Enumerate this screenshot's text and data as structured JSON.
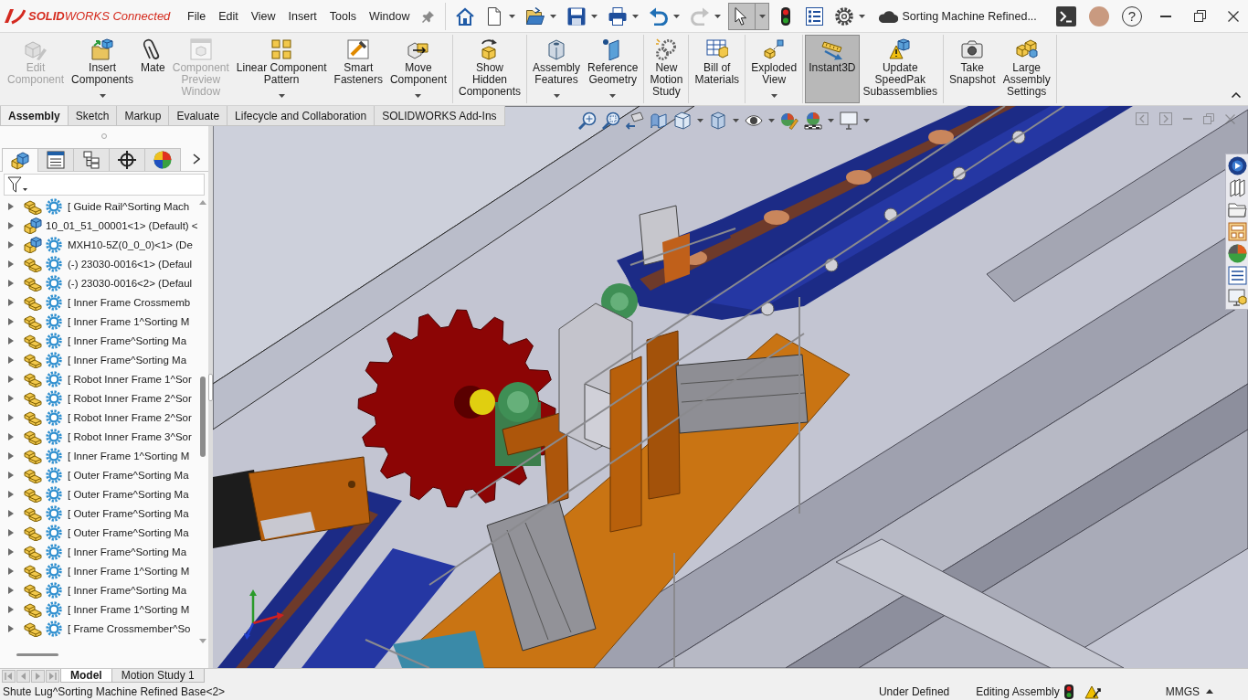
{
  "title_bar": {
    "logo": "**SOLID**WORKS Connected",
    "menu": [
      "File",
      "Edit",
      "View",
      "Insert",
      "Tools",
      "Window"
    ],
    "toolbar": [
      {
        "dropdown": false,
        "disabled": false,
        "on": false
      },
      {
        "dropdown": true,
        "disabled": false,
        "on": false
      },
      {
        "dropdown": true,
        "disabled": false,
        "on": false
      },
      {
        "dropdown": true,
        "disabled": false,
        "on": false
      },
      {
        "dropdown": true,
        "disabled": false,
        "on": false
      },
      {
        "dropdown": true,
        "disabled": false,
        "on": false
      },
      {
        "dropdown": true,
        "disabled": true,
        "on": false
      },
      {
        "dropdown": true,
        "disabled": false,
        "on": true
      },
      {
        "dropdown": false,
        "disabled": false,
        "on": false
      },
      {
        "dropdown": false,
        "disabled": false,
        "on": false
      },
      {
        "dropdown": true,
        "disabled": false,
        "on": false
      }
    ],
    "document_title": "Sorting Machine Refined...",
    "help": "?"
  },
  "ribbon": {
    "groups": [
      {
        "buttons": [
          {
            "label": "Edit\nComponent",
            "disabled": true,
            "dropdown": false,
            "on": false
          },
          {
            "label": "Insert\nComponents",
            "disabled": false,
            "dropdown": true,
            "on": false
          },
          {
            "label": "Mate",
            "disabled": false,
            "dropdown": false,
            "on": false
          },
          {
            "label": "Component\nPreview\nWindow",
            "disabled": true,
            "dropdown": false,
            "on": false
          },
          {
            "label": "Linear Component\nPattern",
            "disabled": false,
            "dropdown": true,
            "on": false
          },
          {
            "label": "Smart\nFasteners",
            "disabled": false,
            "dropdown": false,
            "on": false
          },
          {
            "label": "Move\nComponent",
            "disabled": false,
            "dropdown": true,
            "on": false
          }
        ]
      },
      {
        "buttons": [
          {
            "label": "Show\nHidden\nComponents",
            "disabled": false,
            "dropdown": false,
            "on": false
          }
        ]
      },
      {
        "buttons": [
          {
            "label": "Assembly\nFeatures",
            "disabled": false,
            "dropdown": true,
            "on": false
          },
          {
            "label": "Reference\nGeometry",
            "disabled": false,
            "dropdown": true,
            "on": false
          }
        ]
      },
      {
        "buttons": [
          {
            "label": "New\nMotion\nStudy",
            "disabled": false,
            "dropdown": false,
            "on": false
          }
        ]
      },
      {
        "buttons": [
          {
            "label": "Bill of\nMaterials",
            "disabled": false,
            "dropdown": false,
            "on": false
          }
        ]
      },
      {
        "buttons": [
          {
            "label": "Exploded\nView",
            "disabled": false,
            "dropdown": true,
            "on": false
          }
        ]
      },
      {
        "buttons": [
          {
            "label": "Instant3D",
            "disabled": false,
            "dropdown": false,
            "on": true
          },
          {
            "label": "Update\nSpeedPak\nSubassemblies",
            "disabled": false,
            "dropdown": false,
            "on": false
          }
        ]
      },
      {
        "buttons": [
          {
            "label": "Take\nSnapshot",
            "disabled": false,
            "dropdown": false,
            "on": false
          },
          {
            "label": "Large\nAssembly\nSettings",
            "disabled": false,
            "dropdown": false,
            "on": false
          }
        ]
      }
    ]
  },
  "command_tabs": [
    {
      "label": "Assembly",
      "selected": true
    },
    {
      "label": "Sketch",
      "selected": false
    },
    {
      "label": "Markup",
      "selected": false
    },
    {
      "label": "Evaluate",
      "selected": false
    },
    {
      "label": "Lifecycle and Collaboration",
      "selected": false
    },
    {
      "label": "SOLIDWORKS Add-Ins",
      "selected": false
    }
  ],
  "feature_manager": {
    "tabs": [
      {
        "selected": true
      },
      {
        "selected": false
      },
      {
        "selected": false
      },
      {
        "selected": false
      },
      {
        "selected": false
      }
    ],
    "tree": [
      {
        "label": "[ Guide Rail^Sorting Mach",
        "kind": "assembly",
        "managed": true,
        "expanded": false
      },
      {
        "label": "10_01_51_00001<1> (Default) <",
        "kind": "part",
        "managed": false,
        "expanded": false
      },
      {
        "label": "MXH10-5Z(0_0_0)<1> (De",
        "kind": "part",
        "managed": true,
        "expanded": false
      },
      {
        "label": "(-) 23030-0016<1> (Defaul",
        "kind": "assembly",
        "managed": true,
        "expanded": false
      },
      {
        "label": "(-) 23030-0016<2> (Defaul",
        "kind": "assembly",
        "managed": true,
        "expanded": false
      },
      {
        "label": "[ Inner Frame Crossmemb",
        "kind": "assembly",
        "managed": true,
        "expanded": false
      },
      {
        "label": "[ Inner Frame 1^Sorting M",
        "kind": "assembly",
        "managed": true,
        "expanded": false
      },
      {
        "label": "[ Inner Frame^Sorting Ma",
        "kind": "assembly",
        "managed": true,
        "expanded": false
      },
      {
        "label": "[ Inner Frame^Sorting Ma",
        "kind": "assembly",
        "managed": true,
        "expanded": false
      },
      {
        "label": "[ Robot Inner Frame 1^Sor",
        "kind": "assembly",
        "managed": true,
        "expanded": false
      },
      {
        "label": "[ Robot Inner Frame 2^Sor",
        "kind": "assembly",
        "managed": true,
        "expanded": false
      },
      {
        "label": "[ Robot Inner Frame 2^Sor",
        "kind": "assembly",
        "managed": true,
        "expanded": false
      },
      {
        "label": "[ Robot Inner Frame 3^Sor",
        "kind": "assembly",
        "managed": true,
        "expanded": false
      },
      {
        "label": "[ Inner Frame 1^Sorting M",
        "kind": "assembly",
        "managed": true,
        "expanded": false
      },
      {
        "label": "[ Outer Frame^Sorting Ma",
        "kind": "assembly",
        "managed": true,
        "expanded": false
      },
      {
        "label": "[ Outer Frame^Sorting Ma",
        "kind": "assembly",
        "managed": true,
        "expanded": false
      },
      {
        "label": "[ Outer Frame^Sorting Ma",
        "kind": "assembly",
        "managed": true,
        "expanded": false
      },
      {
        "label": "[ Outer Frame^Sorting Ma",
        "kind": "assembly",
        "managed": true,
        "expanded": false
      },
      {
        "label": "[ Inner Frame^Sorting Ma",
        "kind": "assembly",
        "managed": true,
        "expanded": false
      },
      {
        "label": "[ Inner Frame 1^Sorting M",
        "kind": "assembly",
        "managed": true,
        "expanded": false
      },
      {
        "label": "[ Inner Frame^Sorting Ma",
        "kind": "assembly",
        "managed": true,
        "expanded": false
      },
      {
        "label": "[ Inner Frame 1^Sorting M",
        "kind": "assembly",
        "managed": true,
        "expanded": false
      },
      {
        "label": "[ Frame Crossmember^So",
        "kind": "assembly",
        "managed": true,
        "expanded": false
      }
    ]
  },
  "viewport": {
    "view_tools": [
      {
        "dropdown": false
      },
      {
        "dropdown": false
      },
      {
        "dropdown": false
      },
      {
        "dropdown": false
      },
      {
        "dropdown": true
      },
      {
        "dropdown": true
      },
      {
        "dropdown": true
      },
      {
        "dropdown": false
      },
      {
        "dropdown": true
      },
      {
        "dropdown": true
      }
    ]
  },
  "bottom_tabs": [
    {
      "label": "Model",
      "selected": true
    },
    {
      "label": "Motion Study 1",
      "selected": false
    }
  ],
  "status_bar": {
    "message": "Shute Lug^Sorting Machine Refined Base<2>",
    "sketch_status": "Under Defined",
    "edit_mode": "Editing Assembly",
    "units": "MMGS"
  }
}
